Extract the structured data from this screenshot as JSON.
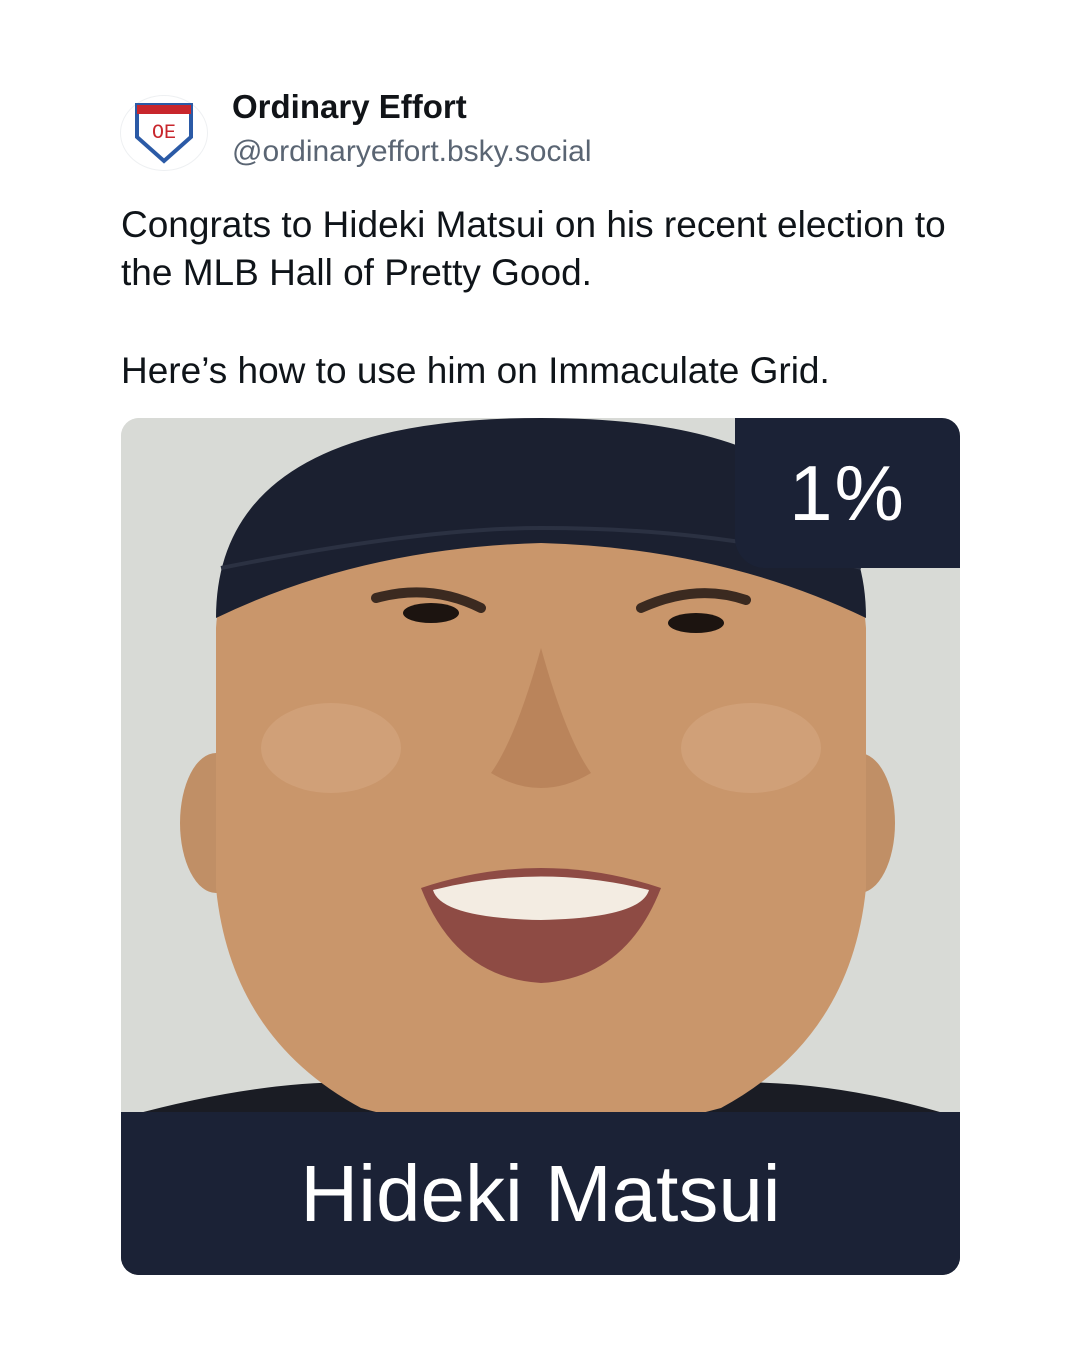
{
  "author": {
    "avatar_icon": "oe-shield-logo-icon",
    "avatar_letters": "OE",
    "name": "Ordinary Effort",
    "handle": "@ordinaryeffort.bsky.social"
  },
  "post": {
    "paragraphs": [
      "Congrats to Hideki Matsui on his recent election to the MLB Hall of Pretty Good.",
      "Here’s how to use him on Immaculate Grid."
    ]
  },
  "card": {
    "percentage": "1%",
    "player_name": "Hideki Matsui"
  },
  "colors": {
    "card_dark": "#1b2236",
    "shield_red": "#c8262c",
    "shield_blue": "#2b5aa6"
  }
}
